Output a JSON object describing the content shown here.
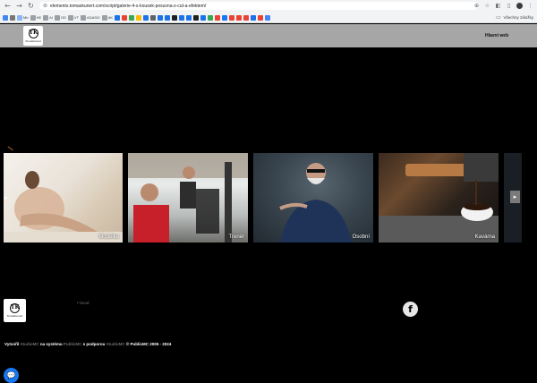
{
  "browser": {
    "url": "elements.tomaskunert.com/script/galerie-4-s-kousek-posuvna-z-cut-a-efektem/",
    "bookmarks": [
      {
        "label": "",
        "color": "#4285f4"
      },
      {
        "label": "",
        "color": "#777777"
      },
      {
        "label": "Mb",
        "color": "#8ab4f8"
      },
      {
        "label": "HE",
        "color": "#9aa0a6"
      },
      {
        "label": "AI",
        "color": "#9aa0a6"
      },
      {
        "label": "OD",
        "color": "#9aa0a6"
      },
      {
        "label": "VT",
        "color": "#9aa0a6"
      },
      {
        "label": "ADASIX",
        "color": "#9aa0a6"
      },
      {
        "label": "AK",
        "color": "#9aa0a6"
      },
      {
        "label": "",
        "color": "#1a73e8"
      },
      {
        "label": "",
        "color": "#ea4335"
      },
      {
        "label": "",
        "color": "#34a853"
      },
      {
        "label": "",
        "color": "#fbbc04"
      },
      {
        "label": "",
        "color": "#1a73e8"
      },
      {
        "label": "",
        "color": "#5f6368"
      },
      {
        "label": "",
        "color": "#1a73e8"
      },
      {
        "label": "",
        "color": "#1a73e8"
      },
      {
        "label": "",
        "color": "#202124"
      },
      {
        "label": "",
        "color": "#1a73e8"
      },
      {
        "label": "",
        "color": "#1a73e8"
      },
      {
        "label": "",
        "color": "#202124"
      },
      {
        "label": "",
        "color": "#1a73e8"
      },
      {
        "label": "",
        "color": "#34a853"
      },
      {
        "label": "",
        "color": "#ea4335"
      },
      {
        "label": "",
        "color": "#1877f2"
      },
      {
        "label": "",
        "color": "#ea4335"
      },
      {
        "label": "",
        "color": "#ea4335"
      },
      {
        "label": "",
        "color": "#ea4335"
      },
      {
        "label": "",
        "color": "#1a73e8"
      },
      {
        "label": "",
        "color": "#ea4335"
      },
      {
        "label": "",
        "color": "#4285f4"
      }
    ],
    "all_bookmarks_label": "Všechny záložky"
  },
  "header": {
    "logo_text": "TomasKunert",
    "logo_mark": "TK",
    "nav_label": "Hlavní web"
  },
  "gallery": {
    "tiles": [
      {
        "caption": "Modelka"
      },
      {
        "caption": "Trenér"
      },
      {
        "caption": "Osobní"
      },
      {
        "caption": "Kavárna"
      },
      {
        "caption": ""
      }
    ],
    "prev_arrow": "◂",
    "next_arrow": "▸"
  },
  "footer": {
    "logo_text": "TomasKunert",
    "logo_mark": "TK",
    "link": "• Úvod",
    "credits": {
      "p1": "Vytvořil ",
      "a1": "StudioMC",
      "p2": " na systému ",
      "a2": "PublicMC",
      "p3": " s podporou ",
      "a3": "StudioMC",
      "p4": " © PublicMC 2005 - 2024"
    }
  },
  "colors": {
    "page_bg": "#000000",
    "header_bg": "#a6a6a6",
    "chat_bubble": "#1877f2"
  }
}
